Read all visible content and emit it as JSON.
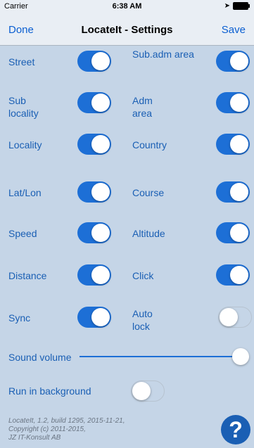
{
  "status_bar": {
    "carrier": "Carrier",
    "time": "6:38 AM"
  },
  "nav": {
    "done": "Done",
    "title": "LocateIt - Settings",
    "save": "Save"
  },
  "settings": {
    "street": {
      "label": "Street",
      "on": true
    },
    "sub_adm_area": {
      "label": "Sub.adm area",
      "on": true
    },
    "sub_locality": {
      "label": "Sub locality",
      "on": true
    },
    "adm_area": {
      "label": "Adm area",
      "on": true
    },
    "locality": {
      "label": "Locality",
      "on": true
    },
    "country": {
      "label": "Country",
      "on": true
    },
    "lat_lon": {
      "label": "Lat/Lon",
      "on": true
    },
    "course": {
      "label": "Course",
      "on": true
    },
    "speed": {
      "label": "Speed",
      "on": true
    },
    "altitude": {
      "label": "Altitude",
      "on": true
    },
    "distance": {
      "label": "Distance",
      "on": true
    },
    "click": {
      "label": "Click",
      "on": true
    },
    "sync": {
      "label": "Sync",
      "on": true
    },
    "auto_lock": {
      "label": "Auto lock",
      "on": false
    },
    "run_in_background": {
      "label": "Run in background",
      "on": false
    }
  },
  "sound_volume": {
    "label": "Sound volume",
    "value": 1.0
  },
  "footer": {
    "line1": "LocateIt, 1.2, build 1295, 2015-11-21,",
    "line2": "Copyright (c) 2011-2015,",
    "line3": "JZ IT-Konsult AB"
  },
  "help": {
    "label": "?"
  },
  "colors": {
    "accent": "#1d6fd6",
    "label": "#1a5fb4",
    "background": "#c5d5e7"
  }
}
